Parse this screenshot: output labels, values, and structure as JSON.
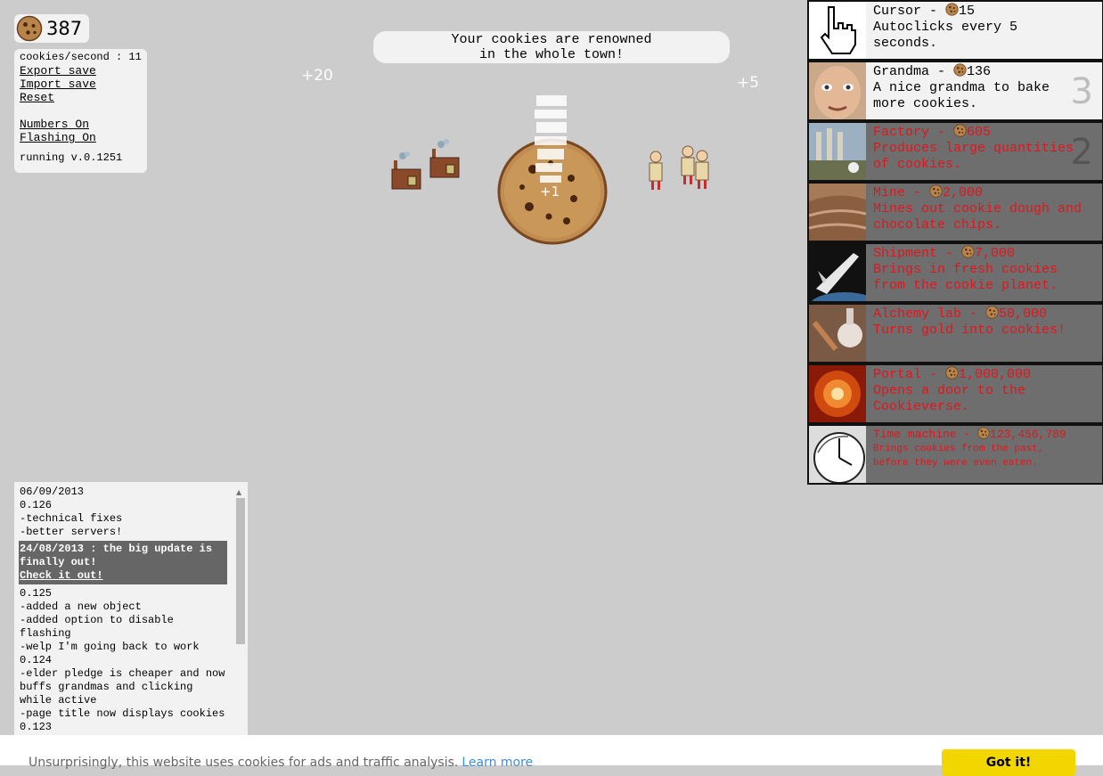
{
  "counter": {
    "value": "387",
    "icon": "cookie-icon"
  },
  "stats": {
    "cps_text": "cookies/second : 11",
    "export_save": "Export save",
    "import_save": "Import save",
    "reset": "Reset",
    "numbers_toggle": "Numbers On",
    "flashing_toggle": "Flashing On",
    "version": "running v.0.1251"
  },
  "message": {
    "line1": "Your cookies are renowned",
    "line2": "in the whole town!"
  },
  "floating_numbers": {
    "left": "+20",
    "right": "+5",
    "click": "+1"
  },
  "shop": {
    "items": [
      {
        "name": "Cursor",
        "price": "15",
        "desc1": "Autoclicks every 5",
        "desc2": "seconds.",
        "owned": "",
        "state": "available",
        "icon": "cursor-hand-icon"
      },
      {
        "name": "Grandma",
        "price": "136",
        "desc1": "A nice grandma to bake",
        "desc2": "more cookies.",
        "owned": "3",
        "state": "available",
        "icon": "grandma-portrait-icon"
      },
      {
        "name": "Factory",
        "price": "605",
        "desc1": "Produces large quantities",
        "desc2": "of cookies.",
        "owned": "2",
        "state": "locked",
        "icon": "factory-photo-icon"
      },
      {
        "name": "Mine",
        "price": "2,000",
        "desc1": "Mines out cookie dough and",
        "desc2": "chocolate chips.",
        "owned": "",
        "state": "locked",
        "icon": "mine-photo-icon"
      },
      {
        "name": "Shipment",
        "price": "7,000",
        "desc1": "Brings in fresh cookies",
        "desc2": "from the cookie planet.",
        "owned": "",
        "state": "locked",
        "icon": "shuttle-photo-icon"
      },
      {
        "name": "Alchemy lab",
        "price": "50,000",
        "desc1": "Turns gold into cookies!",
        "desc2": "",
        "owned": "",
        "state": "locked",
        "icon": "alchemy-photo-icon"
      },
      {
        "name": "Portal",
        "price": "1,000,000",
        "desc1": "Opens a door to the",
        "desc2": "Cookieverse.",
        "owned": "",
        "state": "locked",
        "icon": "portal-photo-icon"
      },
      {
        "name": "Time machine",
        "price": "123,456,789",
        "desc1": "Brings cookies from the past,",
        "desc2": "before they were even eaten.",
        "owned": "",
        "state": "locked",
        "icon": "clock-photo-icon"
      }
    ]
  },
  "changelog": {
    "lines_before": [
      "06/09/2013",
      "0.126",
      "-technical fixes",
      "-better servers!"
    ],
    "highlight": {
      "line1": "24/08/2013 : the big update is",
      "line2": "finally out!",
      "link": "Check it out!"
    },
    "lines_after": [
      "0.125",
      "-added a new object",
      "-added option to disable",
      "flashing",
      "-welp I'm going back to work",
      "0.124",
      "-elder pledge is cheaper and now",
      "buffs grandmas and clicking",
      "while active",
      "-page title now displays cookies",
      "0.123"
    ]
  },
  "banner": {
    "text": "Unsurprisingly, this website uses cookies for ads and traffic analysis.",
    "link": "Learn more",
    "button": "Got it!"
  },
  "colors": {
    "background": "#cccccc",
    "locked_text": "#e0161c",
    "locked_bg": "#6e6e6e",
    "banner_button": "#f1d600",
    "link": "#3f8ed8"
  }
}
